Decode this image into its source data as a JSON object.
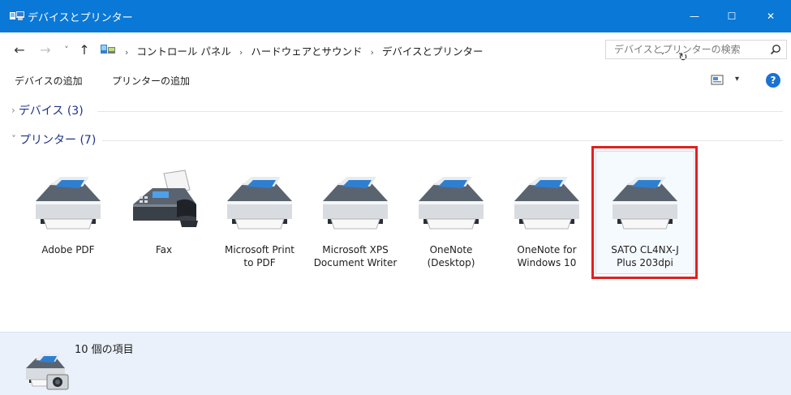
{
  "window": {
    "title": "デバイスとプリンター",
    "controls": {
      "minimize": "—",
      "maximize": "☐",
      "close": "✕"
    },
    "accent_color": "#0a78d7"
  },
  "address": {
    "back": "←",
    "forward": "→",
    "recent": "˅",
    "up": "↑",
    "breadcrumbs": [
      "コントロール パネル",
      "ハードウェアとサウンド",
      "デバイスとプリンター"
    ],
    "separator": "›",
    "dropdown": "˅",
    "refresh": "↻",
    "search_placeholder": "デバイスとプリンターの検索"
  },
  "toolbar": {
    "add_device": "デバイスの追加",
    "add_printer": "プリンターの追加",
    "view_dropdown": "▾",
    "help": "?"
  },
  "groups": {
    "devices": {
      "chevron": "›",
      "label": "デバイス (3)"
    },
    "printers": {
      "chevron": "˅",
      "label": "プリンター (7)"
    }
  },
  "printers": [
    {
      "label_line1": "Adobe PDF",
      "label_line2": "",
      "icon": "printer-icon"
    },
    {
      "label_line1": "Fax",
      "label_line2": "",
      "icon": "fax-icon"
    },
    {
      "label_line1": "Microsoft Print",
      "label_line2": "to PDF",
      "icon": "printer-icon"
    },
    {
      "label_line1": "Microsoft XPS",
      "label_line2": "Document Writer",
      "icon": "printer-icon"
    },
    {
      "label_line1": "OneNote",
      "label_line2": "(Desktop)",
      "icon": "printer-icon"
    },
    {
      "label_line1": "OneNote for",
      "label_line2": "Windows 10",
      "icon": "printer-icon"
    },
    {
      "label_line1": "SATO CL4NX-J",
      "label_line2": "Plus 203dpi",
      "icon": "printer-icon",
      "selected": true
    }
  ],
  "details": {
    "item_count": "10 個の項目",
    "highlight_color": "#e02020"
  }
}
